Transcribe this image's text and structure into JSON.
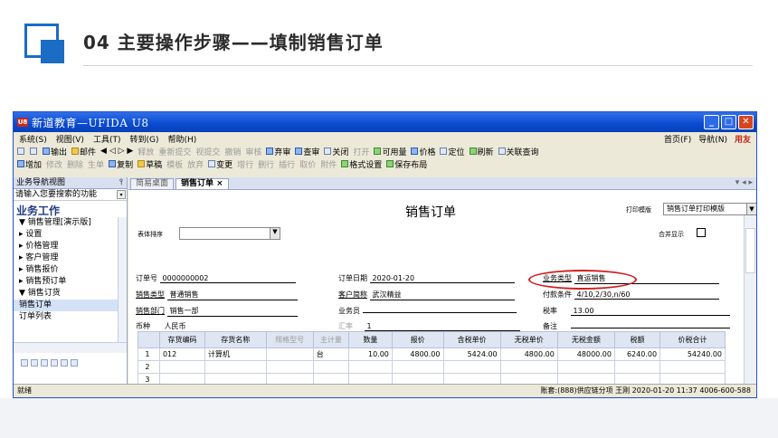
{
  "slide": {
    "title": "04  主要操作步骤——填制销售订单"
  },
  "window": {
    "logo_text": "U8",
    "title": "新道教育—UFIDA U8",
    "buttons": {
      "minimize": "_",
      "maximize": "□",
      "close": "✕"
    }
  },
  "menu": {
    "items": [
      "系统(S)",
      "视图(V)",
      "工具(T)",
      "转到(G)",
      "帮助(H)"
    ],
    "right": [
      "首页(F)",
      "导航(N)"
    ],
    "brand": "用友"
  },
  "toolbar1": [
    "输出",
    "邮件",
    "释放",
    "重新提交",
    "视提交",
    "撤销",
    "审核",
    "弃审",
    "查审",
    "关闭",
    "打开",
    "可用量",
    "价格",
    "定位",
    "刷新",
    "关联查询"
  ],
  "toolbar2": [
    "增加",
    "修改",
    "删除",
    "生单",
    "复制",
    "草稿",
    "模板",
    "放弃",
    "变更",
    "增行",
    "删行",
    "插行",
    "取价",
    "附件",
    "格式设置",
    "保存布局"
  ],
  "left_pane": {
    "header": "业务导航视图",
    "search_placeholder": "请输入您要搜索的功能",
    "section": "业务工作",
    "tree": [
      "▼ 销售管理[演示版]",
      "  ▸ 设置",
      "  ▸ 价格管理",
      "  ▸ 客户管理",
      "  ▸ 销售报价",
      "  ▸ 销售预订单",
      "  ▼ 销售订货",
      "      销售订单",
      "      订单列表"
    ]
  },
  "tabs": [
    "简易桌面",
    "销售订单 ×"
  ],
  "doc": {
    "title": "销售订单",
    "print_label": "打印模版",
    "print_value": "销售订单打印模版",
    "sort_label": "表体排序",
    "merge_label": "合并显示",
    "fields": {
      "order_no_label": "订单号",
      "order_no": "0000000002",
      "order_date_label": "订单日期",
      "order_date": "2020-01-20",
      "biz_type_label": "业务类型",
      "biz_type": "直运销售",
      "sales_type_label": "销售类型",
      "sales_type": "普通销售",
      "customer_label": "客户简称",
      "customer": "武汉精益",
      "pay_terms_label": "付款条件",
      "pay_terms": "4/10,2/30,n/60",
      "dept_label": "销售部门",
      "dept": "销售一部",
      "salesman_label": "业务员",
      "salesman": "",
      "tax_rate_label": "税率",
      "tax_rate": "13.00",
      "currency_label": "币种",
      "currency": "人民币",
      "fx_label": "汇率",
      "fx": "1",
      "remark_label": "备注",
      "remark": ""
    },
    "table": {
      "headers": [
        "",
        "存货编码",
        "存货名称",
        "规格型号",
        "主计量",
        "数量",
        "报价",
        "含税单价",
        "无税单价",
        "无税金额",
        "税额",
        "价税合计"
      ],
      "rows": [
        [
          "1",
          "012",
          "计算机",
          "",
          "台",
          "10.00",
          "4800.00",
          "5424.00",
          "4800.00",
          "48000.00",
          "6240.00",
          "54240.00"
        ],
        [
          "2",
          "",
          "",
          "",
          "",
          "",
          "",
          "",
          "",
          "",
          "",
          ""
        ],
        [
          "3",
          "",
          "",
          "",
          "",
          "",
          "",
          "",
          "",
          "",
          "",
          ""
        ]
      ]
    }
  },
  "status": {
    "left": "就绪",
    "right": "账套:(888)供应链分项  王刚  2020-01-20 11:37  4006-600-588"
  }
}
